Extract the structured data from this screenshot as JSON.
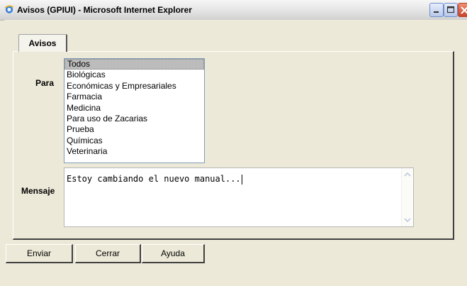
{
  "window": {
    "title": "Avisos (GPIUI) - Microsoft Internet Explorer",
    "icon": "internet-explorer-icon",
    "controls": [
      "minimize-icon",
      "maximize-icon",
      "close-icon"
    ]
  },
  "tabs": [
    {
      "label": "Avisos",
      "active": true
    }
  ],
  "form": {
    "para_label": "Para",
    "mensaje_label": "Mensaje",
    "recipients": [
      {
        "label": "Todos",
        "selected": true
      },
      {
        "label": "Biológicas",
        "selected": false
      },
      {
        "label": "Económicas y Empresariales",
        "selected": false
      },
      {
        "label": "Farmacia",
        "selected": false
      },
      {
        "label": "Medicina",
        "selected": false
      },
      {
        "label": "Para uso de Zacarias",
        "selected": false
      },
      {
        "label": "Prueba",
        "selected": false
      },
      {
        "label": "Químicas",
        "selected": false
      },
      {
        "label": "Veterinaria",
        "selected": false
      }
    ],
    "message_value": "Estoy cambiando el nuevo manual..."
  },
  "buttons": {
    "enviar": "Enviar",
    "cerrar": "Cerrar",
    "ayuda": "Ayuda"
  }
}
